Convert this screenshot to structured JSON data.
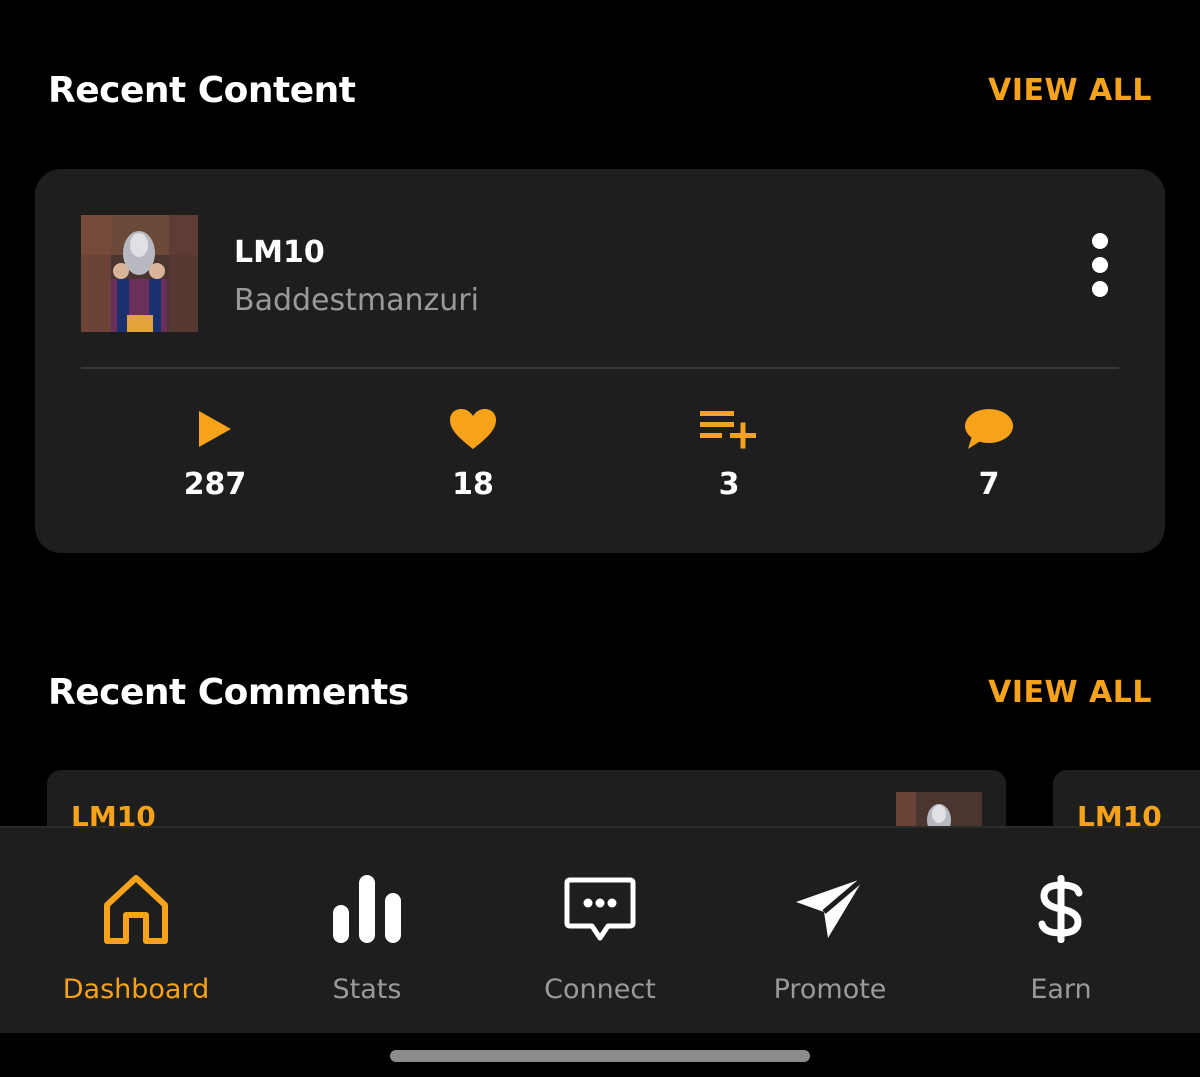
{
  "recent_content": {
    "title": "Recent Content",
    "view_all": "VIEW ALL",
    "item": {
      "title": "LM10",
      "artist": "Baddestmanzuri",
      "stats": {
        "plays": "287",
        "likes": "18",
        "playlist_adds": "3",
        "comments": "7"
      }
    }
  },
  "recent_comments": {
    "title": "Recent Comments",
    "view_all": "VIEW ALL",
    "items": [
      {
        "title": "LM10"
      },
      {
        "title": "LM10"
      }
    ]
  },
  "nav": {
    "items": [
      {
        "label": "Dashboard",
        "icon": "home-icon",
        "active": true
      },
      {
        "label": "Stats",
        "icon": "bar-chart-icon",
        "active": false
      },
      {
        "label": "Connect",
        "icon": "message-icon",
        "active": false
      },
      {
        "label": "Promote",
        "icon": "send-icon",
        "active": false
      },
      {
        "label": "Earn",
        "icon": "dollar-icon",
        "active": false
      }
    ]
  },
  "colors": {
    "accent": "#f6a21a",
    "background": "#000000",
    "card": "#1e1e1e",
    "muted_text": "#9a9a9a"
  }
}
